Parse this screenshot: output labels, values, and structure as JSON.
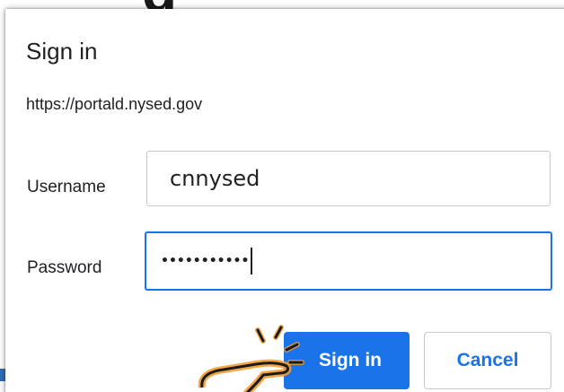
{
  "background": {
    "glyph": "g"
  },
  "dialog": {
    "title": "Sign in",
    "origin": "https://portald.nysed.gov",
    "username": {
      "label": "Username",
      "value": "cnnysed"
    },
    "password": {
      "label": "Password",
      "masked_value": "•••••••••••"
    },
    "buttons": {
      "sign_in": "Sign in",
      "cancel": "Cancel"
    }
  },
  "colors": {
    "accent": "#1a73e8",
    "pointer_highlight": "#f39c32"
  },
  "icons": {
    "pointer": "hand-pointer-icon"
  }
}
